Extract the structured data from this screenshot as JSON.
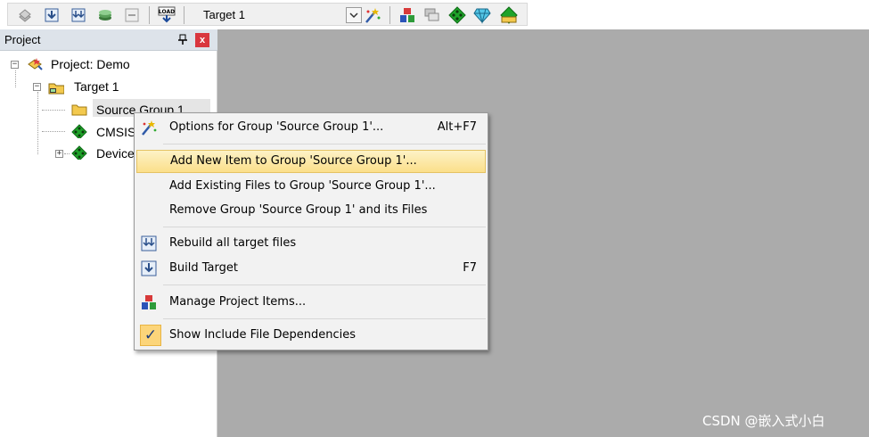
{
  "toolbar": {
    "target_value": "Target 1",
    "icons_left": [
      "translate-icon",
      "build-icon",
      "rebuild-icon",
      "batch-build-icon",
      "stop-build-icon",
      "download-load-icon"
    ],
    "icons_right": [
      "target-options-icon",
      "manage-project-icon",
      "select-packs-icon",
      "manage-rte-icon",
      "event-recorder-icon"
    ]
  },
  "panel": {
    "title": "Project",
    "close_label": "x"
  },
  "tree": {
    "project": "Project: Demo",
    "target": "Target 1",
    "group": "Source Group 1",
    "cmsis": "CMSIS",
    "device": "Device"
  },
  "menu": {
    "options": {
      "label": "Options for Group 'Source Group 1'...",
      "shortcut": "Alt+F7"
    },
    "add_new": {
      "label": "Add New  Item to Group 'Source Group 1'..."
    },
    "add_existing": {
      "label": "Add Existing Files to Group 'Source Group 1'..."
    },
    "remove": {
      "label": "Remove Group 'Source Group 1' and its Files"
    },
    "rebuild": {
      "label": "Rebuild all target files"
    },
    "build": {
      "label": "Build Target",
      "shortcut": "F7"
    },
    "manage": {
      "label": "Manage Project Items..."
    },
    "show_deps": {
      "label": "Show Include File Dependencies",
      "checked": "✓"
    }
  },
  "watermark": "CSDN @嵌入式小白",
  "colors": {
    "highlight": "#fbdf8a",
    "workspace": "#ababab",
    "close_button": "#d9363e",
    "folder": "#f3c94e",
    "rte_green": "#1fa32a"
  }
}
